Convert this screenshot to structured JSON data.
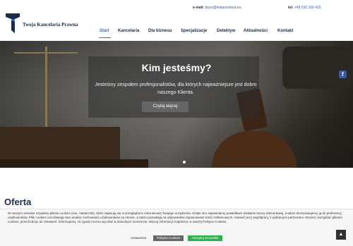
{
  "header": {
    "brand": "Twoja Kancelaria Prawna",
    "email_label": "e-mail:",
    "email": "biuro@twkancelaria.eu",
    "tel_label": "tel:",
    "tel": "+48 530 166 433"
  },
  "nav": {
    "items": [
      {
        "label": "Start"
      },
      {
        "label": "Kancelaria"
      },
      {
        "label": "Dla biznesu"
      },
      {
        "label": "Specjalizacje"
      },
      {
        "label": "Detektyw"
      },
      {
        "label": "Aktualności"
      },
      {
        "label": "Kontakt"
      }
    ]
  },
  "hero": {
    "title": "Kim jesteśmy?",
    "text": "Jesteśmy zespołem profesjonalistów, dla których najważniejsze jest dobro naszego Klienta.",
    "button": "Czytaj więcej"
  },
  "section": {
    "title": "Oferta"
  },
  "social": {
    "facebook": "f"
  },
  "cookie": {
    "text": "W naszym serwisie używamy plików cookies (tzw. ciasteczek), które zapisują się w przeglądarce internetowej Twojego urządzenia. Dzięki nim zapewniamy prawidłowe działanie strony internetowej, a także dostosowujemy ją do preferencji użytkowników. Pliki cookies umożliwiają nam analizę zachowania użytkowników na stronie, a także pozwalają na odpowiednie dopasowanie treści reklamowych, również przy współpracy z wybranymi partnerami. Możesz zarządzać plikami cookies, przechodząc do Ustawień. Informujemy, że zgodę można wycofać w dowolnym momencie. Więcej informacji znajdziesz w naszej Polityce Cookies.",
    "settings": "Ustawienia",
    "policy": "Polityka Cookies",
    "accept": "Akceptuj wszystkie"
  },
  "scroll_top": "▲",
  "colors": {
    "brand": "#1c2b46",
    "accent": "#2f6fd6",
    "accept": "#2bb24c"
  }
}
